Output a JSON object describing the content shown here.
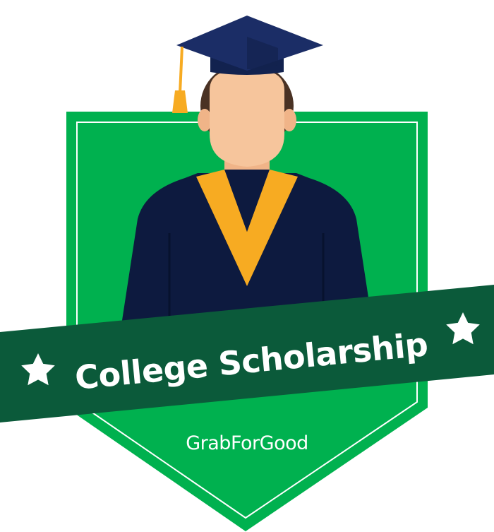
{
  "badge": {
    "title": "College Scholarship",
    "brand": {
      "part1": "Grab",
      "part2": "ForGood"
    }
  },
  "icons": {
    "left_star": "star-icon",
    "right_star": "star-icon",
    "figure": "graduate-icon",
    "cap": "graduation-cap-icon"
  },
  "colors": {
    "shield": "#00b14f",
    "shield_border": "#ffffff",
    "banner": "#0b5a3a",
    "gown": "#0d1a3f",
    "cap": "#1b2d66",
    "stole": "#f7ab22",
    "skin": "#f6c59c",
    "hair": "#4a3224",
    "text": "#ffffff"
  }
}
